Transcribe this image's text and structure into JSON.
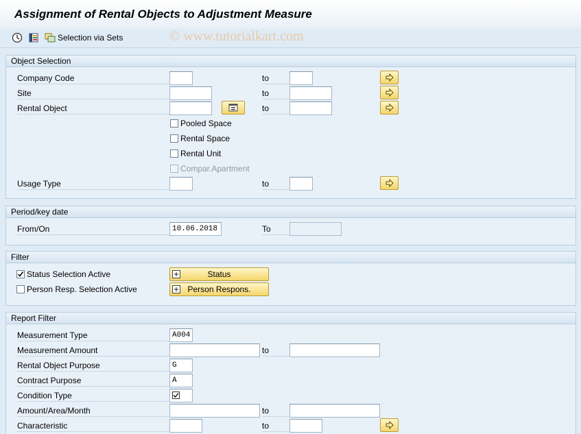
{
  "title": "Assignment of Rental Objects to Adjustment Measure",
  "watermark": "© www.tutorialkart.com",
  "toolbar": {
    "selection_sets_label": "Selection via Sets"
  },
  "object_selection": {
    "header": "Object Selection",
    "to_label": "to",
    "company_code_label": "Company Code",
    "site_label": "Site",
    "rental_object_label": "Rental Object",
    "pooled_space_label": "Pooled Space",
    "rental_space_label": "Rental Space",
    "rental_unit_label": "Rental Unit",
    "compar_apartment_label": "Compar.Apartment",
    "usage_type_label": "Usage Type"
  },
  "period": {
    "header": "Period/key date",
    "from_on_label": "From/On",
    "from_on_value": "10.06.2018",
    "to_label": "To"
  },
  "filter": {
    "header": "Filter",
    "status_selection_label": "Status Selection Active",
    "status_selection_checked": true,
    "person_resp_label": "Person Resp. Selection Active",
    "person_resp_checked": false,
    "status_button": "Status",
    "person_button": "Person Respons."
  },
  "report_filter": {
    "header": "Report Filter",
    "to_label": "to",
    "measurement_type_label": "Measurement Type",
    "measurement_type_value": "A004",
    "measurement_amount_label": "Measurement Amount",
    "rental_object_purpose_label": "Rental Object Purpose",
    "rental_object_purpose_value": "G",
    "contract_purpose_label": "Contract Purpose",
    "contract_purpose_value": "A",
    "condition_type_label": "Condition Type",
    "amount_area_month_label": "Amount/Area/Month",
    "characteristic_label": "Characteristic"
  },
  "icons": {
    "execute": "execute-icon",
    "variant": "get-variant-icon",
    "sets": "selection-sets-icon",
    "multiple_selection": "multiple-selection-arrow-icon",
    "matchcode": "matchcode-icon"
  }
}
